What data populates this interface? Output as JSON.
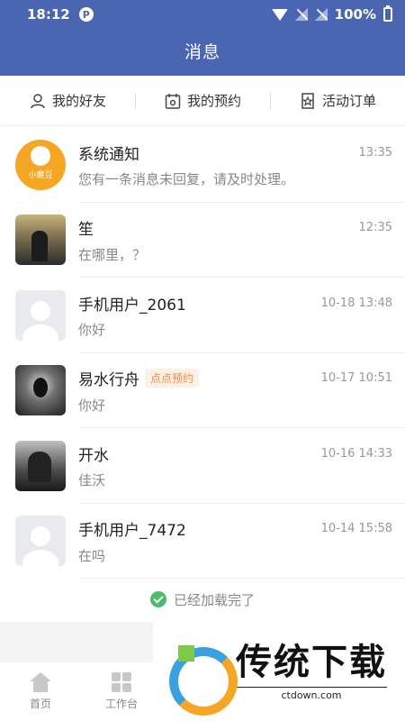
{
  "status_bar": {
    "time": "18:12",
    "app_icon": "P",
    "battery": "100%"
  },
  "header": {
    "title": "消息"
  },
  "tabs": [
    {
      "label": "我的好友",
      "icon": "person-icon"
    },
    {
      "label": "我的预约",
      "icon": "calendar-icon"
    },
    {
      "label": "活动订单",
      "icon": "star-order-icon"
    }
  ],
  "messages": [
    {
      "name": "系统通知",
      "time": "13:35",
      "preview": "您有一条消息未回复，请及时处理。",
      "avatar": "logo",
      "logo_text": "小蘑豆"
    },
    {
      "name": "笙",
      "time": "12:35",
      "preview": "在哪里，？",
      "avatar": "photo"
    },
    {
      "name": "手机用户_2061",
      "time": "10-18 13:48",
      "preview": "你好",
      "avatar": "default"
    },
    {
      "name": "易水行舟",
      "tag": "点点预约",
      "time": "10-17 10:51",
      "preview": "你好",
      "avatar": "photo"
    },
    {
      "name": "开水",
      "time": "10-16 14:33",
      "preview": "佳沃",
      "avatar": "photo"
    },
    {
      "name": "手机用户_7472",
      "time": "10-14 15:58",
      "preview": "在吗",
      "avatar": "default"
    }
  ],
  "footer": {
    "loaded_text": "已经加载完了"
  },
  "bottom_nav": [
    {
      "label": "首页",
      "icon": "home-icon"
    },
    {
      "label": "工作台",
      "icon": "workbench-icon"
    }
  ],
  "watermark": {
    "title": "传统下载",
    "url": "ctdown.com"
  },
  "colors": {
    "header_bg": "#4a66b2",
    "tag_text": "#f08a3a",
    "tag_bg": "#fdf0e6",
    "check_green": "#4cbb6c"
  }
}
